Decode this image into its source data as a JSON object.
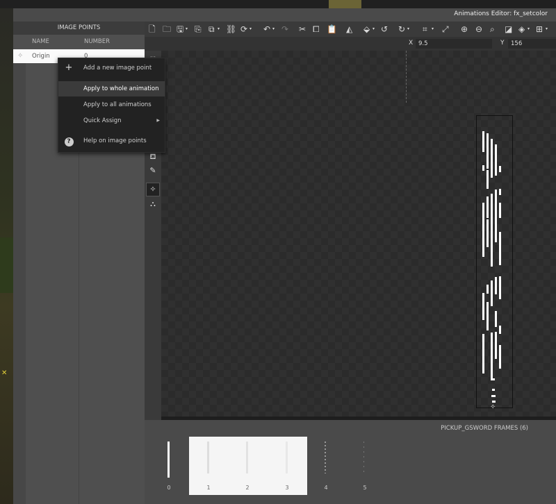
{
  "window": {
    "title": "Animations Editor: fx_setcolor"
  },
  "image_points": {
    "header": "IMAGE POINTS",
    "col_name": "NAME",
    "col_number": "NUMBER",
    "rows": [
      {
        "name": "Origin",
        "number": "0"
      }
    ]
  },
  "context_menu": {
    "items": [
      {
        "label": "Add a new image point",
        "icon": "plus-icon"
      },
      {
        "label": "Apply to whole animation",
        "highlighted": true
      },
      {
        "label": "Apply to all animations"
      },
      {
        "label": "Quick Assign",
        "submenu": true
      },
      {
        "label": "Help on image points",
        "icon": "help-icon"
      }
    ]
  },
  "coords": {
    "x_label": "X",
    "x_value": "9.5",
    "y_label": "Y",
    "y_value": "156"
  },
  "frames": {
    "title": "PICKUP_GSWORD FRAMES (6)",
    "items": [
      {
        "num": "0"
      },
      {
        "num": "1"
      },
      {
        "num": "2"
      },
      {
        "num": "3"
      },
      {
        "num": "4"
      },
      {
        "num": "5"
      }
    ]
  },
  "colors": {
    "selection": "#f5f5f5",
    "panel": "#4f4f4f",
    "canvas": "#2b2b2b"
  }
}
